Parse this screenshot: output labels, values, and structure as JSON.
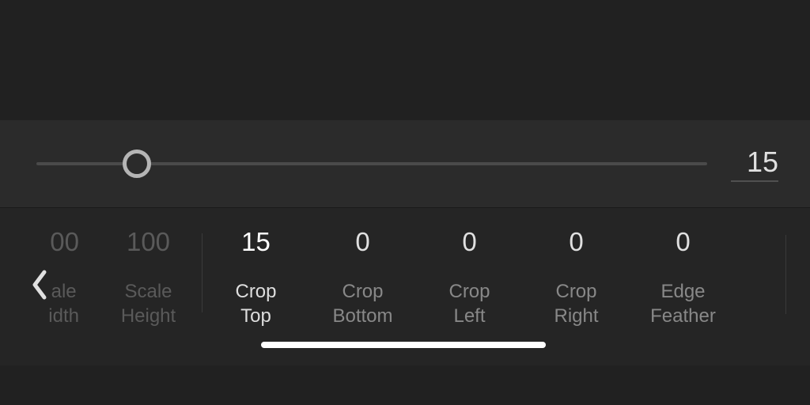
{
  "slider": {
    "value": "15",
    "handle_position_percent": 15
  },
  "params": [
    {
      "value": "00",
      "label": "ale\nidth",
      "dimmed": true,
      "partial": "left"
    },
    {
      "value": "100",
      "label": "Scale\nHeight",
      "dimmed": true
    },
    {
      "value": "15",
      "label": "Crop\nTop",
      "active": true
    },
    {
      "value": "0",
      "label": "Crop\nBottom"
    },
    {
      "value": "0",
      "label": "Crop\nLeft"
    },
    {
      "value": "0",
      "label": "Crop\nRight"
    },
    {
      "value": "0",
      "label": "Edge\nFeather"
    }
  ],
  "colors": {
    "accent": "#4a8cf5",
    "bg_dark": "#212121",
    "bg_medium": "#2b2b2b",
    "text_primary": "#e0e0e0",
    "text_secondary": "#888"
  }
}
